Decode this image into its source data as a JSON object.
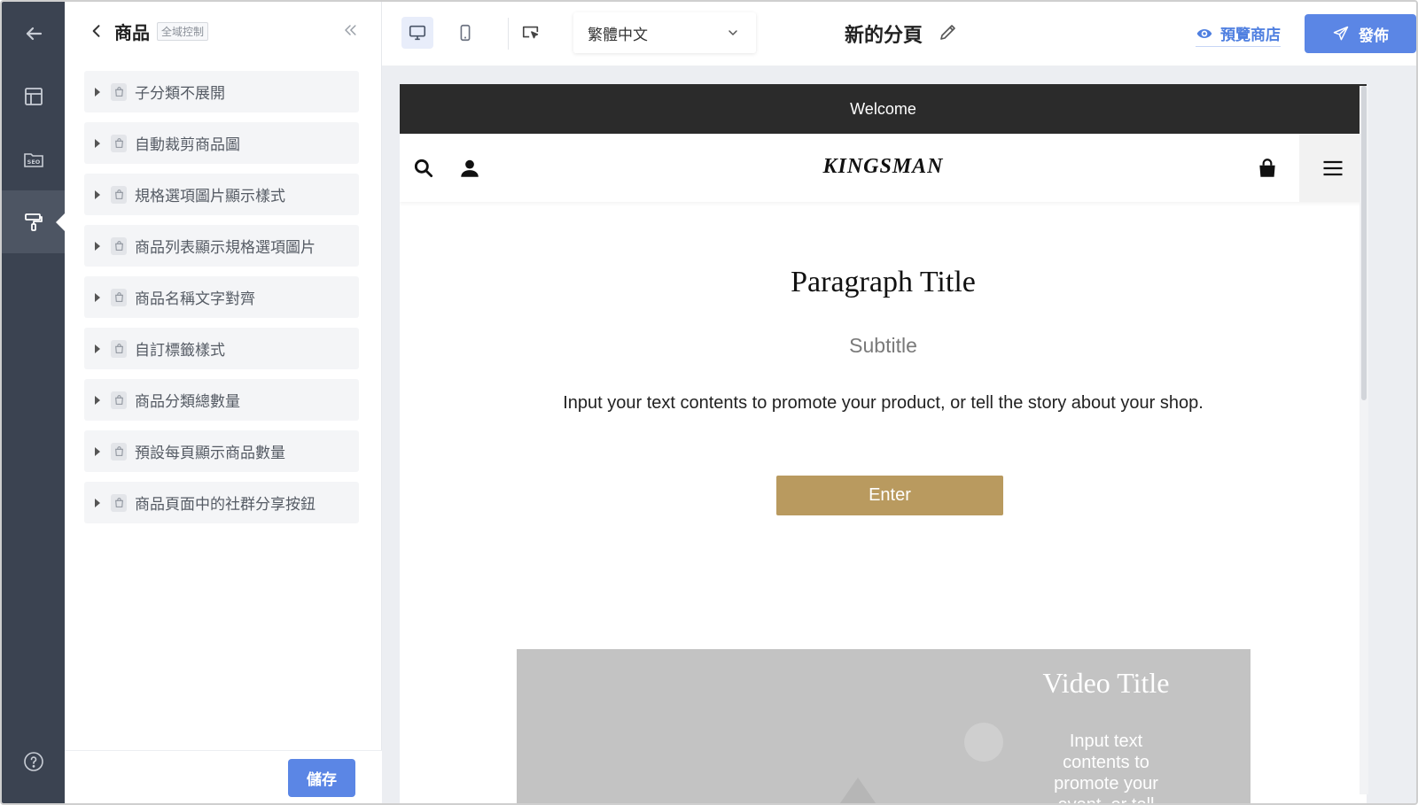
{
  "rail": {
    "items": [
      {
        "icon": "arrow-left-icon"
      },
      {
        "icon": "layout-icon"
      },
      {
        "icon": "seo-folder-icon",
        "label": "SEO"
      },
      {
        "icon": "paint-roller-icon",
        "active": true
      },
      {
        "icon": "help-circle-icon"
      }
    ]
  },
  "panel": {
    "title": "商品",
    "tag": "全域控制",
    "items": [
      {
        "label": "子分類不展開"
      },
      {
        "label": "自動裁剪商品圖"
      },
      {
        "label": "規格選項圖片顯示樣式"
      },
      {
        "label": "商品列表顯示規格選項圖片"
      },
      {
        "label": "商品名稱文字對齊"
      },
      {
        "label": "自訂標籤樣式"
      },
      {
        "label": "商品分類總數量"
      },
      {
        "label": "預設每頁顯示商品數量"
      },
      {
        "label": "商品頁面中的社群分享按鈕"
      }
    ],
    "save_label": "儲存"
  },
  "toolbar": {
    "language": "繁體中文",
    "page_name": "新的分頁",
    "preview_label": "預覽商店",
    "publish_label": "發佈"
  },
  "site": {
    "announcement": "Welcome",
    "logo": "KINGSMAN",
    "paragraph_title": "Paragraph Title",
    "subtitle": "Subtitle",
    "body": "Input your text contents to promote your product, or tell the story about your shop.",
    "button_label": "Enter",
    "video_title": "Video Title",
    "video_text": "Input text contents to promote your event, or tell"
  },
  "colors": {
    "rail_bg": "#3b4351",
    "accent_blue": "#5b86e5",
    "gold_button": "#b99a5f",
    "announce_bg": "#2b2b2b"
  }
}
